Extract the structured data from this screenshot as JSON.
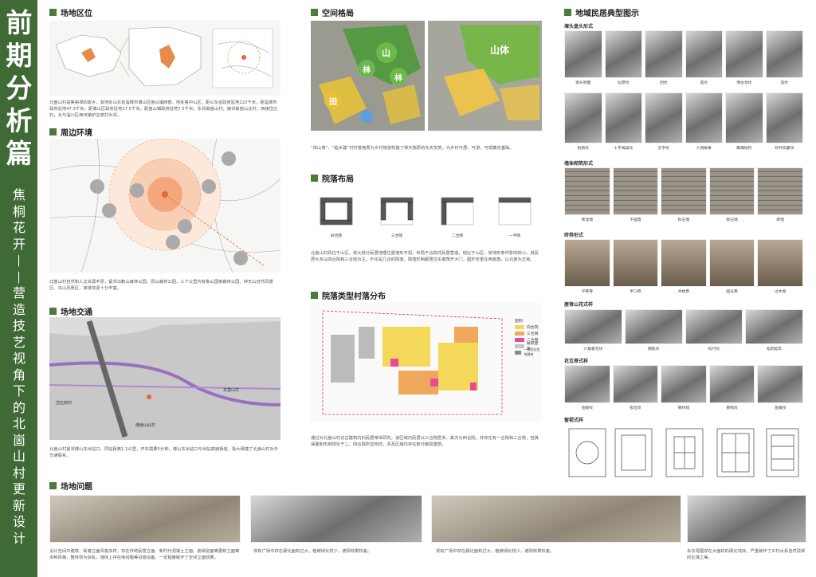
{
  "sidebar": {
    "title": [
      "前",
      "期",
      "分",
      "析",
      "篇"
    ],
    "subtitle": [
      "焦",
      "桐",
      "花",
      "开",
      "—",
      "—",
      "营",
      "造",
      "技",
      "艺",
      "视",
      "角",
      "下",
      "的",
      "北",
      "崮",
      "山",
      "村",
      "更",
      "新",
      "设",
      "计"
    ]
  },
  "sections": {
    "site_location": "场地区位",
    "surroundings": "周边环境",
    "traffic": "场地交通",
    "spatial_pattern": "空间格局",
    "courtyard_layout": "院落布局",
    "courtyard_distribution": "院落类型村落分布",
    "typical_dwellings": "地域民居典型图示",
    "site_problems": "场地问题"
  },
  "texts": {
    "location": "北崮山村是焦裕禄的故乡，其地处山东省淄博市博山区崮山镇西部，地处鲁中山区，距山东省政府驻地122千米，距淄博市政府驻地47.5千米，距博山区政府驻地17.5千米，距崮山镇政府驻地7.5千米，东邻南崮山村，南邻南崮山北村，西接岱庄村，北与淄川区西河镇炉宝泉村为邻。",
    "surroundings": "北崮山村自然和人文资源丰厚，紧邻马鞍山森林公园、原山森林公园，三个公里内有鲁山国家森林公园、钟天山自然风景区、充山风景区，旅游资源十分丰富。",
    "traffic": "北崮山村紧邻博山东出站口，同站距离1.2公里，开车需要5分钟，博山东出站口与出站高速相连，极大便捷了北崮山村对外交通联系。",
    "spatial": "“依山傍”、“临水建”村村落格局为乡村旅游构建了得天独厚的先天优势，为乡村可居、可游、可观奠定基础。",
    "courtyard": "北崮山村具位于山区，依大部分民居地理位置地形平坦，布局于合院式民居营造，结比于山区，受地形条件影响较小，其民居大多以四合院和三合院为主，不论是几合的院落，院落形制都居住东南角开大门，圆形安重在西南角，以北房为正房。",
    "distribution": "通过对北崮山村访古建筑内的民居单体研究，该区域内民居以三合院居多，其次为四合院，并存在有一合院和二合院，但其保量和形制规化于二、四合院所显较低，多及区域内存在部分破损建筑。",
    "problem1": "设计空间中建筑、街巷立面风格多样，存在传统民居立面、新时代混凝土立面、瓷砖贴面等更新立面等多种风格，整体较为杂乱，墙体上存在电线箱等设施设备，一定程度破坏了空间立面效果。",
    "problem2": "现有广场中存在硬化面积过大，植被绿化较少，遮阴效果较差。",
    "problem3": "现有广场中存在硬化面积过大，植被绿化较少，遮阴效果较差。",
    "problem4": "永东周围存在大面积的硬化地块，严重破坏了乡村水系自然驳岸的生境之美。"
  },
  "map_labels": {
    "region_a": "东营山村",
    "region_b": "岱庄南村",
    "region_c": "南崮山北村",
    "shan": "山",
    "lin": "林",
    "tian": "田",
    "shanti": "山体"
  },
  "courtyards": [
    "四合院",
    "三合院",
    "二合院",
    "一字院"
  ],
  "legend": {
    "title": "图例:",
    "items": [
      {
        "label": "四合院",
        "color": "#f4d85a"
      },
      {
        "label": "三合院",
        "color": "#f0a85c"
      },
      {
        "label": "二合院",
        "color": "#e84a9a"
      },
      {
        "label": "破损建筑",
        "color": "#c4c4c4"
      },
      {
        "label": "一合院及其他建筑",
        "color": "#8a8a8a"
      }
    ]
  },
  "dwellings": {
    "sub1": "墀头盘头形式",
    "row1": [
      "墀头侧面",
      "仙草纹",
      "回纹",
      "莲纹",
      "博古龙纹",
      "莲纹"
    ],
    "row2": [
      "松鹤纹",
      "十字海棠纹",
      "云字纹",
      "人物故事",
      "鹰嘴纸符",
      "虾杆安霸纹"
    ],
    "sub2": "墙体砌筑形式",
    "walls": [
      "砖混墙",
      "干摆墙",
      "料石墙",
      "碎石墙",
      "砖墙"
    ],
    "sub3": "砖券形式",
    "arches": [
      "平券券",
      "半口券",
      "木枕券",
      "圆光券",
      "过木窗"
    ],
    "sub4": "屋脊山花式样",
    "ridges": [
      "六角菱花纹",
      "钢板纹",
      "松竹纹",
      "松鹤延年"
    ],
    "sub5": "花瓦脊式样",
    "tiles": [
      "鱼鳞纹",
      "板瓦纹",
      "钢纹钱",
      "铜钱纹",
      "鱼鳞纹"
    ],
    "sub6": "窗棂式样"
  }
}
